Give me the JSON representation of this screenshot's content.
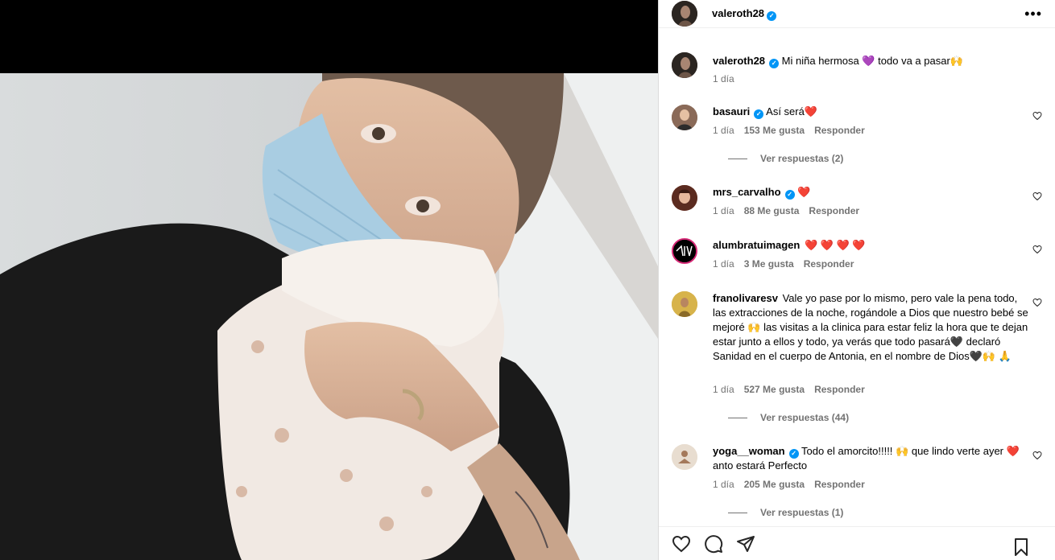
{
  "post": {
    "author": "valeroth28",
    "caption": "Mi niña hermosa 💜 todo va a pasar🙌",
    "time": "1 día"
  },
  "comments": [
    {
      "user": "basauri",
      "verified": true,
      "text": "Así será❤️",
      "time": "1 día",
      "likes": "153 Me gusta",
      "reply": "Responder",
      "replies": "Ver respuestas (2)"
    },
    {
      "user": "mrs_carvalho",
      "verified": true,
      "text": "❤️",
      "time": "1 día",
      "likes": "88 Me gusta",
      "reply": "Responder"
    },
    {
      "user": "alumbratuimagen",
      "verified": false,
      "text": "❤️ ❤️ ❤️ ❤️",
      "time": "1 día",
      "likes": "3 Me gusta",
      "reply": "Responder"
    },
    {
      "user": "franolivaresv",
      "verified": false,
      "text": "Vale yo pase por lo mismo, pero vale la pena todo, las extracciones de la noche, rogándole a Dios que nuestro bebé se mejoré 🙌 las visitas a la clinica para estar feliz la hora que te dejan estar junto a ellos y todo, ya verás que todo pasará🖤 declaró Sanidad en el cuerpo de Antonia, en el nombre de Dios🖤🙌 🙏",
      "time": "1 día",
      "likes": "527 Me gusta",
      "reply": "Responder",
      "replies": "Ver respuestas (44)"
    },
    {
      "user": "yoga__woman",
      "verified": true,
      "text": "Todo el amorcito!!!!! 🙌 que lindo verte ayer ❤️ anto estará Perfecto",
      "time": "1 día",
      "likes": "205 Me gusta",
      "reply": "Responder",
      "replies": "Ver respuestas (1)"
    }
  ],
  "icons": {
    "more": "more-options-icon",
    "like": "heart-icon",
    "comment": "comment-icon",
    "share": "send-icon",
    "save": "bookmark-icon"
  },
  "colors": {
    "verified": "#0095f6",
    "muted": "#737373",
    "heart": "#ed4956"
  }
}
